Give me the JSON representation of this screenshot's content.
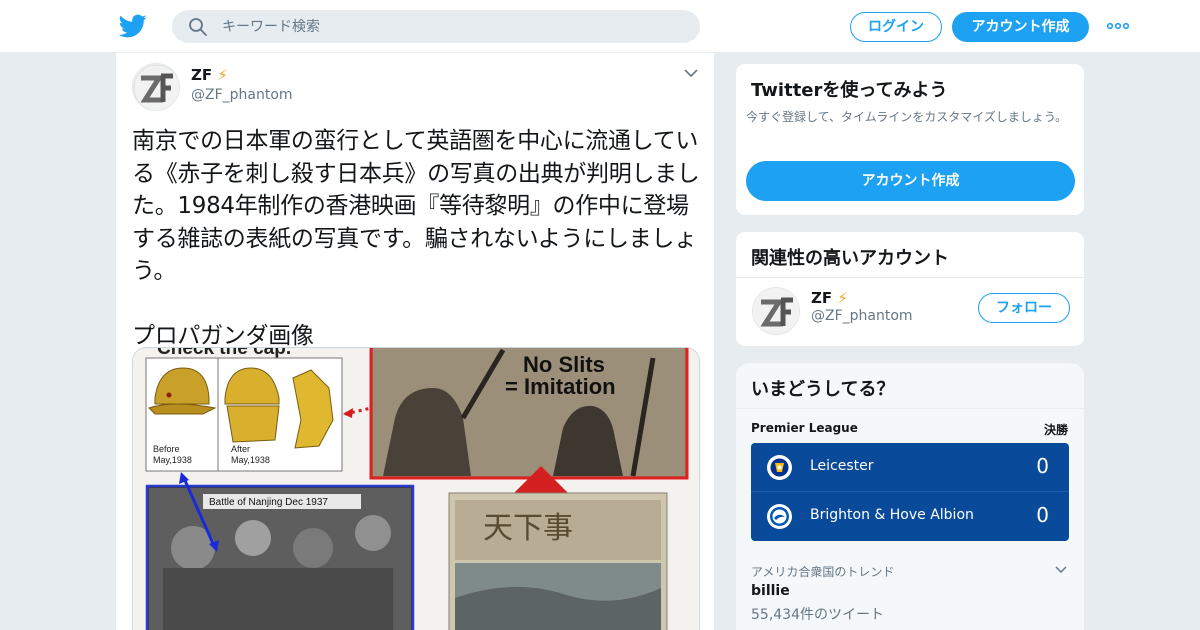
{
  "header": {
    "search_placeholder": "キーワード検索",
    "login_label": "ログイン",
    "signup_label": "アカウント作成"
  },
  "tweet": {
    "author_name": "ZF",
    "author_badge": "⚡",
    "author_handle": "@ZF_phantom",
    "text": "南京での日本軍の蛮行として英語圏を中心に流通している《赤子を刺し殺す日本兵》の写真の出典が判明しました。1984年制作の香港映画『等待黎明』の作中に登場する雑誌の表紙の写真です。騙されないようにしましょう。",
    "text2": "プロパガンダ画像",
    "media": {
      "caption_top": "Check the cap.",
      "label_before": "Before",
      "label_before_date": "May,1938",
      "label_after": "After",
      "label_after_date": "May,1938",
      "label_noslits": "No Slits",
      "label_imitation": "= Imitation",
      "label_battle": "Battle of Nanjing Dec 1937",
      "magazine_title": "天下事"
    }
  },
  "signup_card": {
    "title": "Twitterを使ってみよう",
    "description": "今すぐ登録して、タイムラインをカスタマイズしましょう。",
    "button": "アカウント作成"
  },
  "related_card": {
    "title": "関連性の高いアカウント",
    "name": "ZF",
    "badge": "⚡",
    "handle": "@ZF_phantom",
    "follow_label": "フォロー"
  },
  "trends_card": {
    "title": "いまどうしてる？",
    "league": "Premier League",
    "stage": "決勝",
    "teams": [
      {
        "name": "Leicester",
        "score": "0"
      },
      {
        "name": "Brighton & Hove Albion",
        "score": "0"
      }
    ],
    "trend_location": "アメリカ合衆国のトレンド",
    "trend_term": "billie",
    "trend_count": "55,434件のツイート"
  },
  "colors": {
    "brand": "#1da1f2",
    "background": "#e6ecf0",
    "scoreboard": "#0a4a9b"
  }
}
